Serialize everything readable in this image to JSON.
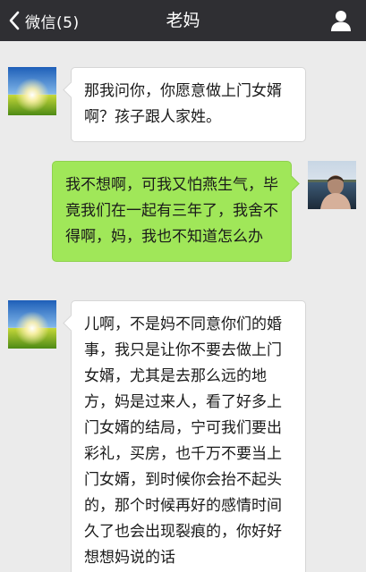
{
  "header": {
    "back_label": "微信(5)",
    "title": "老妈"
  },
  "icons": {
    "back": "chevron-left-icon",
    "profile": "person-icon"
  },
  "colors": {
    "topbar": "#2f2f33",
    "background": "#ebebeb",
    "bubble_sent": "#a0e759",
    "bubble_received": "#ffffff"
  },
  "messages": [
    {
      "sender": "contact",
      "text": "那我问你，你愿意做上门女婿啊？孩子跟人家姓。"
    },
    {
      "sender": "me",
      "text": "我不想啊，可我又怕燕生气，毕竟我们在一起有三年了，我舍不得啊，妈，我也不知道怎么办"
    },
    {
      "sender": "contact",
      "text": "儿啊，不是妈不同意你们的婚事，我只是让你不要去做上门女婿，尤其是去那么远的地方，妈是过来人，看了好多上门女婿的结局，宁可我们要出彩礼，买房，也千万不要当上门女婿，到时候你会抬不起头的，那个时候再好的感情时间久了也会出现裂痕的，你好好想想妈说的话"
    }
  ]
}
